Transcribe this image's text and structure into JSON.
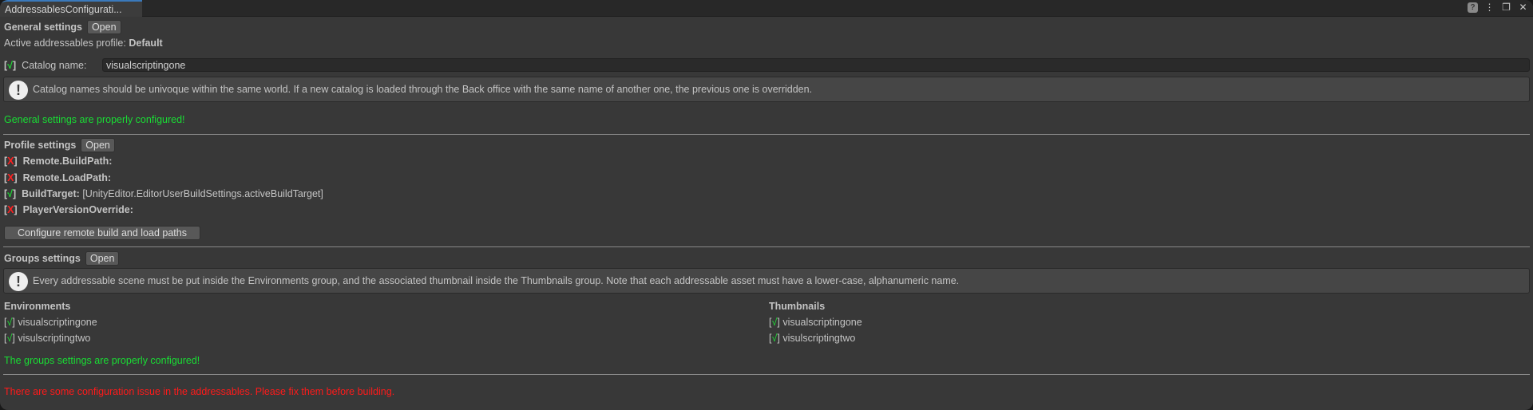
{
  "window": {
    "tab_title": "AddressablesConfigurati...",
    "icons": [
      "help-icon",
      "more-icon",
      "maximize-icon",
      "close-icon"
    ]
  },
  "general": {
    "title": "General settings",
    "open": "Open",
    "profile_label": "Active addressables profile:",
    "profile_value": "Default",
    "catalog_check": "√",
    "catalog_label": "Catalog name:",
    "catalog_value": "visualscriptingone",
    "info": "Catalog names should be univoque within the same world. If a new catalog is loaded through the Back office with the same name of another one, the previous one is overridden.",
    "status": "General settings are properly configured!"
  },
  "profile": {
    "title": "Profile settings",
    "open": "Open",
    "items": [
      {
        "mark": "X",
        "ok": false,
        "label": "Remote.BuildPath:",
        "value": ""
      },
      {
        "mark": "X",
        "ok": false,
        "label": "Remote.LoadPath:",
        "value": ""
      },
      {
        "mark": "√",
        "ok": true,
        "label": "BuildTarget:",
        "value": "[UnityEditor.EditorUserBuildSettings.activeBuildTarget]"
      },
      {
        "mark": "X",
        "ok": false,
        "label": "PlayerVersionOverride:",
        "value": ""
      }
    ],
    "configure_button": "Configure remote build and load paths"
  },
  "groups": {
    "title": "Groups settings",
    "open": "Open",
    "info": "Every addressable scene must be put inside the Environments group, and the associated thumbnail inside the Thumbnails group. Note that each addressable asset must have a lower-case, alphanumeric name.",
    "environments": {
      "title": "Environments",
      "items": [
        {
          "mark": "√",
          "name": "visualscriptingone"
        },
        {
          "mark": "√",
          "name": "visulscriptingtwo"
        }
      ]
    },
    "thumbnails": {
      "title": "Thumbnails",
      "items": [
        {
          "mark": "√",
          "name": "visualscriptingone"
        },
        {
          "mark": "√",
          "name": "visulscriptingtwo"
        }
      ]
    },
    "status": "The groups settings are properly configured!"
  },
  "footer_error": "There are some configuration issue in the addressables. Please fix them before building.",
  "colors": {
    "ok": "#19dd34",
    "error": "#ff1a1a",
    "background": "#383838"
  }
}
